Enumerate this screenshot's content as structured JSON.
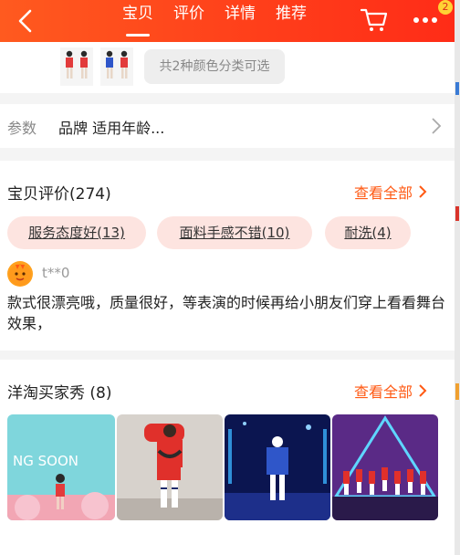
{
  "header": {
    "tabs": [
      {
        "label": "宝贝",
        "active": true
      },
      {
        "label": "评价",
        "active": false
      },
      {
        "label": "详情",
        "active": false
      },
      {
        "label": "推荐",
        "active": false
      }
    ],
    "badge_count": "2"
  },
  "color_strip": {
    "summary": "共2种颜色分类可选"
  },
  "params": {
    "label": "参数",
    "value": "品牌 适用年龄..."
  },
  "reviews": {
    "title": "宝贝评价(274)",
    "see_all": "查看全部",
    "tags": [
      "服务态度好(13)",
      "面料手感不错(10)",
      "耐洗(4)"
    ],
    "item": {
      "user": "t**0",
      "text": "款式很漂亮哦，质量很好，等表演的时候再给小朋友们穿上看看舞台效果，"
    }
  },
  "buyer_show": {
    "title": "洋淘买家秀 (8)",
    "see_all": "查看全部",
    "photo1_text": "NG SOON"
  },
  "colors": {
    "brand_orange": "#ff5a14",
    "header_red": "#ff3d1a",
    "tag_bg": "#fde4e0"
  }
}
